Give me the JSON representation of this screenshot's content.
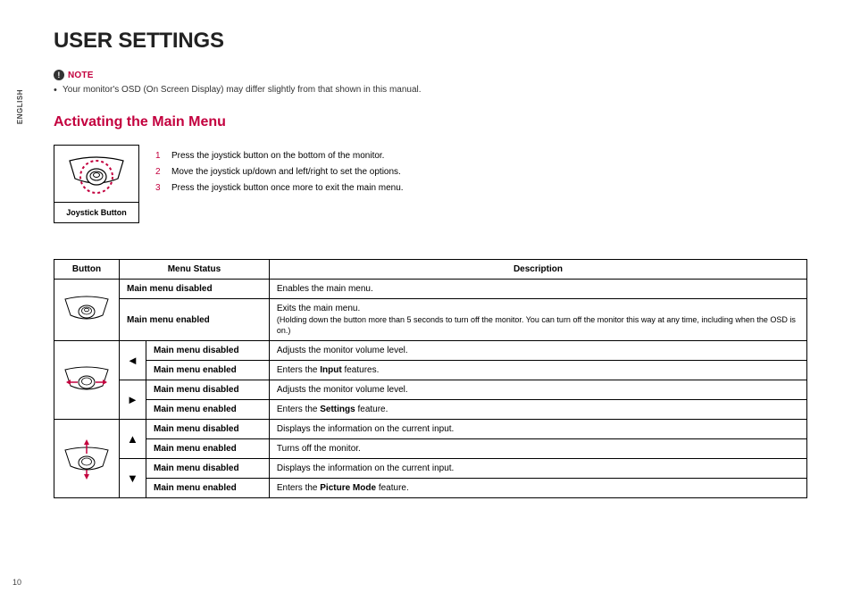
{
  "language_tab": "ENGLISH",
  "page_number": "10",
  "title": "USER SETTINGS",
  "note_label": "NOTE",
  "note_text": "Your monitor's OSD (On Screen Display) may differ slightly from that shown in this manual.",
  "section_heading": "Activating the Main Menu",
  "joystick_caption": "Joystick Button",
  "steps": [
    "Press the joystick button on the bottom of the monitor.",
    "Move the joystick up/down and left/right to set the options.",
    "Press the joystick button once more to exit the main menu."
  ],
  "table": {
    "headers": {
      "button": "Button",
      "status": "Menu Status",
      "description": "Description"
    },
    "group0": {
      "status0": "Main menu disabled",
      "desc0": "Enables the main menu.",
      "status1": "Main menu enabled",
      "desc1_line1": "Exits the main menu.",
      "desc1_line2": "(Holding down the button more than 5 seconds to turn off the monitor. You can turn off the monitor this way at any time, including when the OSD is on.)"
    },
    "group1": {
      "status0": "Main menu disabled",
      "desc0": "Adjusts the monitor volume level.",
      "status1": "Main menu enabled",
      "desc1_pre": "Enters the ",
      "desc1_bold": "Input",
      "desc1_post": " features.",
      "status2": "Main menu disabled",
      "desc2": "Adjusts the monitor volume level.",
      "status3": "Main menu enabled",
      "desc3_pre": "Enters the ",
      "desc3_bold": "Settings",
      "desc3_post": " feature."
    },
    "group2": {
      "status0": "Main menu disabled",
      "desc0": "Displays the information on the current input.",
      "status1": "Main menu enabled",
      "desc1": "Turns off the monitor.",
      "status2": "Main menu disabled",
      "desc2": "Displays the information on the current input.",
      "status3": "Main menu enabled",
      "desc3_pre": "Enters the ",
      "desc3_bold": "Picture Mode",
      "desc3_post": " feature."
    },
    "arrows": {
      "left": "◄",
      "right": "►",
      "up": "▲",
      "down": "▼"
    }
  }
}
